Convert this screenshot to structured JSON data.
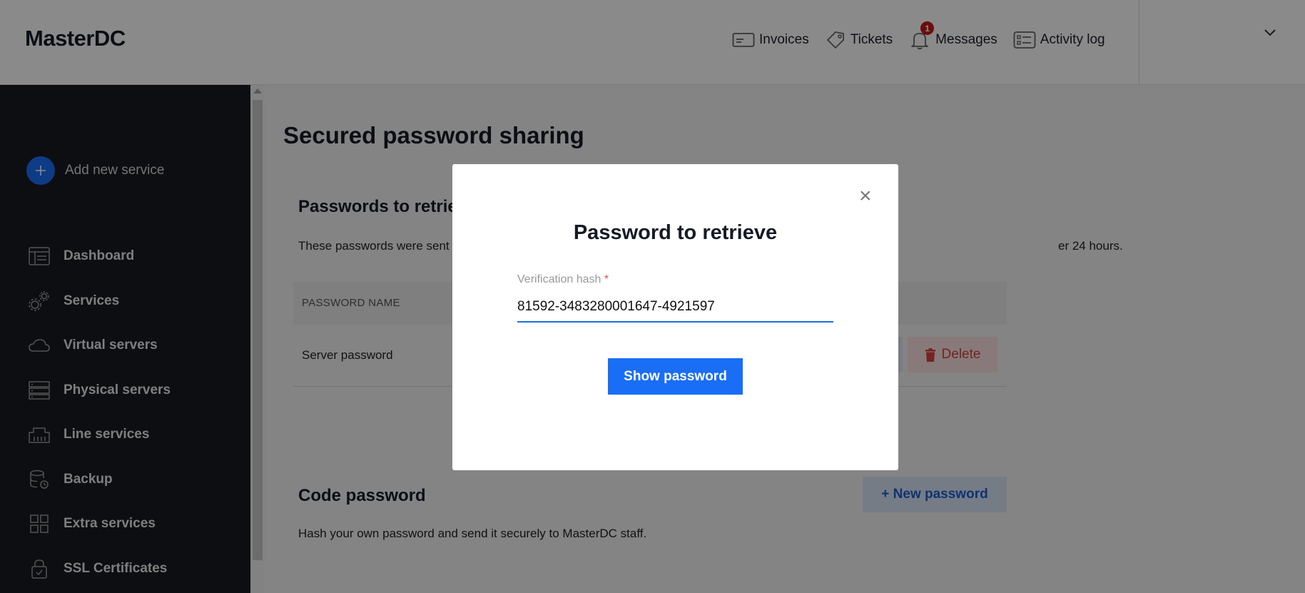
{
  "header": {
    "logo": "MasterDC",
    "nav": [
      {
        "label": "Invoices",
        "icon": "invoice-icon"
      },
      {
        "label": "Tickets",
        "icon": "ticket-icon"
      },
      {
        "label": "Messages",
        "icon": "bell-icon",
        "badge": "1"
      },
      {
        "label": "Activity log",
        "icon": "activity-log-icon"
      }
    ],
    "user_menu_icon": "chevron-down-icon"
  },
  "sidebar": {
    "add_service": "Add new service",
    "items": [
      {
        "label": "Dashboard",
        "icon": "dashboard-icon"
      },
      {
        "label": "Services",
        "icon": "gears-icon"
      },
      {
        "label": "Virtual servers",
        "icon": "cloud-icon"
      },
      {
        "label": "Physical servers",
        "icon": "server-icon"
      },
      {
        "label": "Line services",
        "icon": "network-port-icon"
      },
      {
        "label": "Backup",
        "icon": "database-backup-icon"
      },
      {
        "label": "Extra services",
        "icon": "grid-icon"
      },
      {
        "label": "SSL Certificates",
        "icon": "lock-icon"
      }
    ]
  },
  "main": {
    "title": "Secured password sharing",
    "retrieve_section": {
      "title": "Passwords to retrie",
      "description_left": "These passwords were sent l",
      "description_right": "er 24 hours.",
      "column_header": "PASSWORD NAME",
      "rows": [
        {
          "name": "Server password",
          "delete_label": "Delete"
        }
      ]
    },
    "code_section": {
      "title": "Code password",
      "description": "Hash your own password and send it securely to MasterDC staff.",
      "new_password_label": "+ New password"
    }
  },
  "modal": {
    "title": "Password to retrieve",
    "close_symbol": "×",
    "field_label": "Verification hash",
    "required_mark": "*",
    "field_value": "81592-3483280001647-4921597",
    "submit_label": "Show password"
  },
  "colors": {
    "accent": "#1a6ef5",
    "sidebar_bg": "#181a21",
    "danger": "#d94141",
    "badge": "#c81818"
  }
}
